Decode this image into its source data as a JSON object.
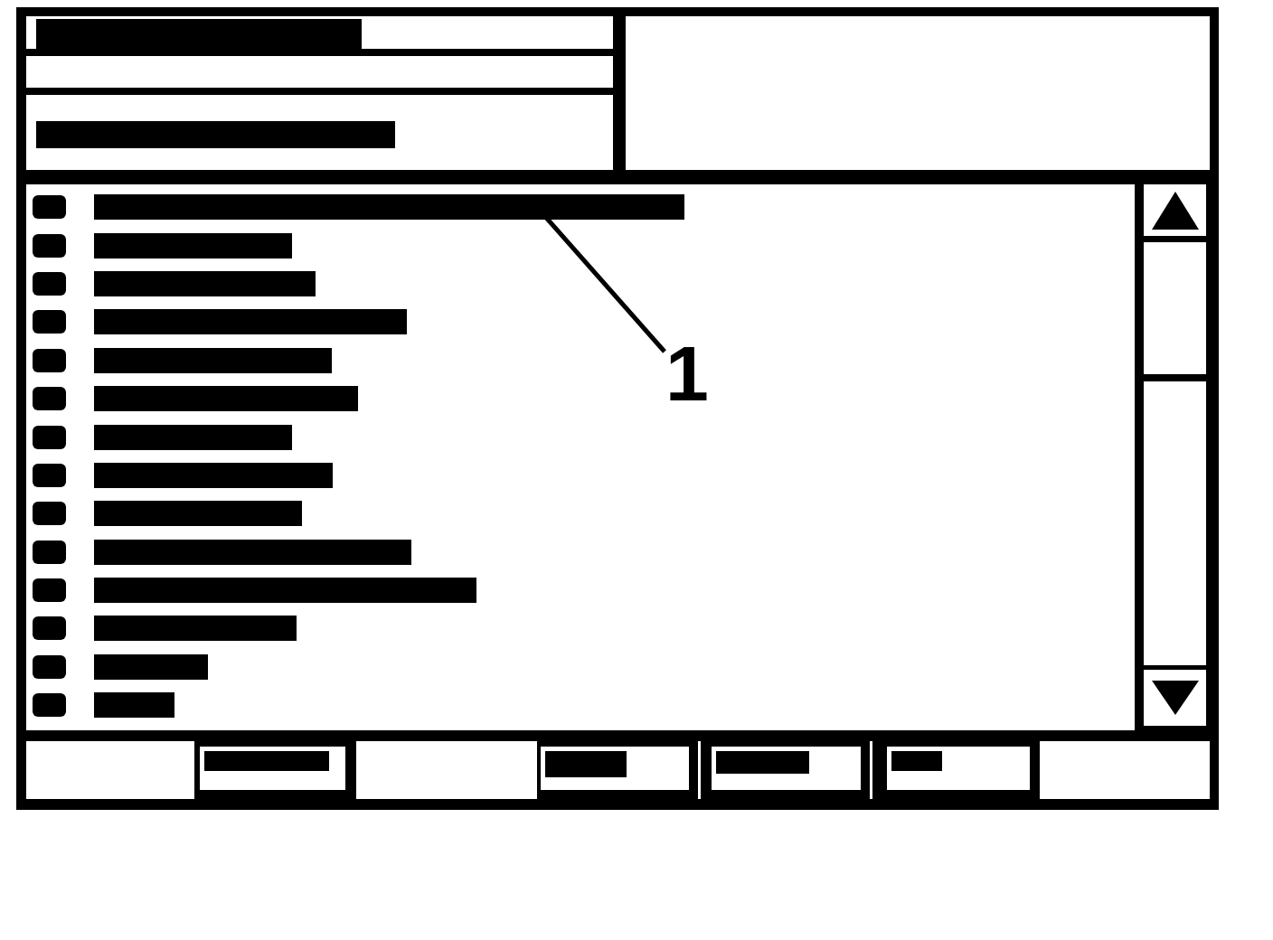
{
  "header": {
    "title": {
      "redacted": true
    },
    "subtitle": {
      "redacted": true
    }
  },
  "list": {
    "rows": [
      {
        "redacted": true
      },
      {
        "redacted": true
      },
      {
        "redacted": true
      },
      {
        "redacted": true
      },
      {
        "redacted": true
      },
      {
        "redacted": true
      },
      {
        "redacted": true
      },
      {
        "redacted": true
      },
      {
        "redacted": true
      },
      {
        "redacted": true
      },
      {
        "redacted": true
      },
      {
        "redacted": true
      },
      {
        "redacted": true
      },
      {
        "redacted": true
      }
    ]
  },
  "callout": {
    "label": "1"
  },
  "footer": {
    "cells": [
      {
        "kind": "blank"
      },
      {
        "kind": "key",
        "redacted": true
      },
      {
        "kind": "blank"
      },
      {
        "kind": "key",
        "redacted": true
      },
      {
        "kind": "key",
        "redacted": true
      },
      {
        "kind": "key",
        "redacted": true
      },
      {
        "kind": "blank"
      }
    ]
  }
}
